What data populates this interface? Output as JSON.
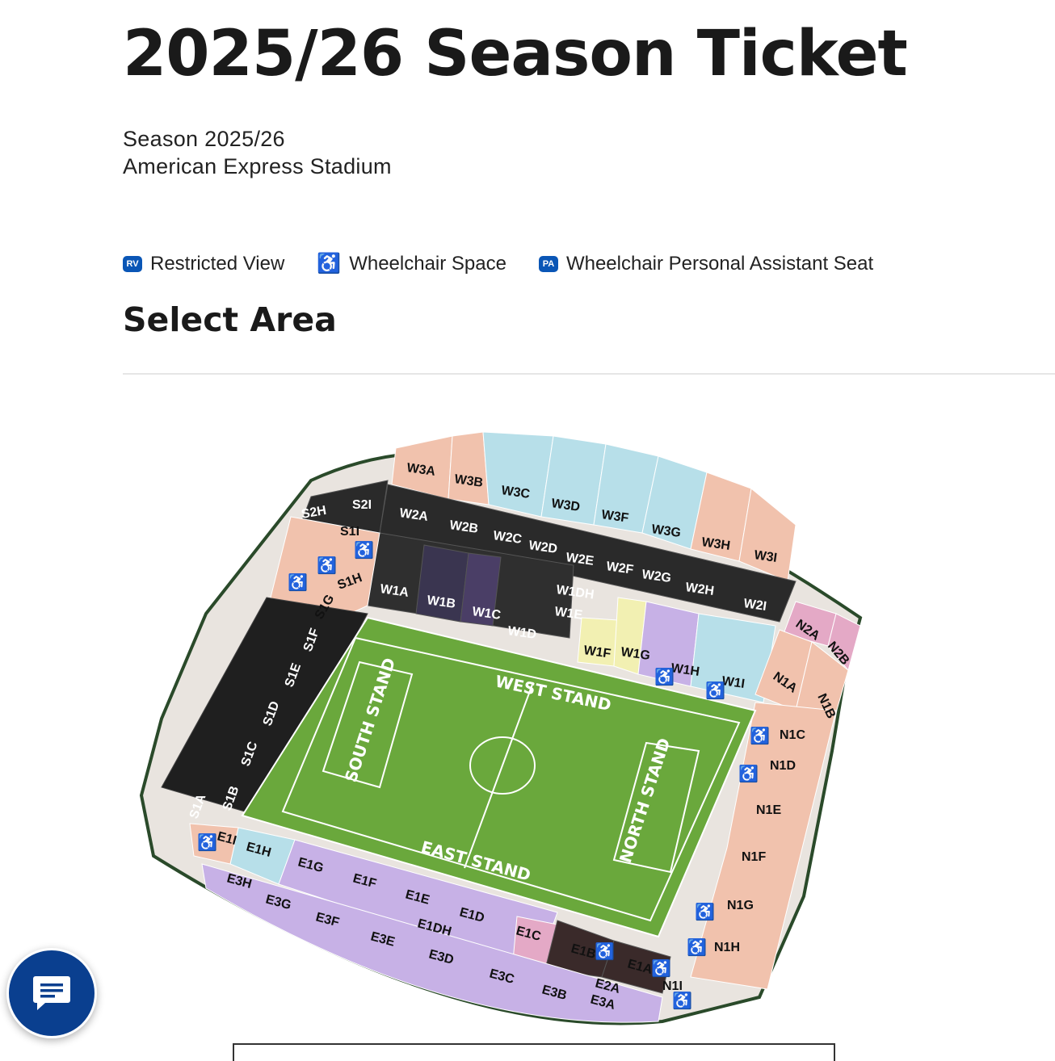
{
  "header": {
    "title": "2025/26 Season Ticket",
    "season": "Season 2025/26",
    "venue": "American Express Stadium"
  },
  "legend": {
    "restricted_view": {
      "badge": "RV",
      "label": "Restricted View"
    },
    "wheelchair_space": {
      "icon": "wheelchair-icon",
      "label": "Wheelchair Space"
    },
    "personal_assistant": {
      "badge": "PA",
      "label": "Wheelchair Personal Assistant Seat"
    }
  },
  "select_area": {
    "title": "Select Area"
  },
  "stands": {
    "west": "WEST STAND",
    "south": "SOUTH STAND",
    "north": "NORTH STAND",
    "east": "EAST STAND"
  },
  "sections": {
    "W3A": "W3A",
    "W3B": "W3B",
    "W3C": "W3C",
    "W3D": "W3D",
    "W3F": "W3F",
    "W3G": "W3G",
    "W3H": "W3H",
    "W3I": "W3I",
    "S2H": "S2H",
    "S2I": "S2I",
    "W2A": "W2A",
    "W2B": "W2B",
    "W2C": "W2C",
    "W2D": "W2D",
    "W2E": "W2E",
    "W2F": "W2F",
    "W2G": "W2G",
    "W2H": "W2H",
    "W2I": "W2I",
    "S1I": "S1I",
    "S1H": "S1H",
    "S1G": "S1G",
    "S1F": "S1F",
    "S1E": "S1E",
    "S1D": "S1D",
    "S1C": "S1C",
    "S1B": "S1B",
    "S1A": "S1A",
    "W1A": "W1A",
    "W1B": "W1B",
    "W1C": "W1C",
    "W1DH": "W1DH",
    "W1E": "W1E",
    "W1D": "W1D",
    "W1F": "W1F",
    "W1G": "W1G",
    "W1H": "W1H",
    "W1I": "W1I",
    "N2A": "N2A",
    "N2B": "N2B",
    "N1A": "N1A",
    "N1B": "N1B",
    "N1C": "N1C",
    "N1D": "N1D",
    "N1E": "N1E",
    "N1F": "N1F",
    "N1G": "N1G",
    "N1H": "N1H",
    "N1I": "N1I",
    "E1I": "E1I",
    "E1H": "E1H",
    "E1G": "E1G",
    "E1F": "E1F",
    "E1E": "E1E",
    "E1DH": "E1DH",
    "E1D": "E1D",
    "E1C": "E1C",
    "E1B": "E1B",
    "E1A": "E1A",
    "E3H": "E3H",
    "E3G": "E3G",
    "E3F": "E3F",
    "E3E": "E3E",
    "E3D": "E3D",
    "E3C": "E3C",
    "E3B": "E3B",
    "E3A": "E3A",
    "E2A": "E2A"
  },
  "colors": {
    "salmon": "#f1c2ad",
    "light_blue": "#b7dfe9",
    "lavender": "#c7b1e6",
    "yellow": "#f2f0b2",
    "pink": "#e4a9c6",
    "dark": "#2a2a2a",
    "pitch": "#6aa83c",
    "accent": "#0a56b6"
  },
  "chat": {
    "icon": "chat-icon"
  }
}
